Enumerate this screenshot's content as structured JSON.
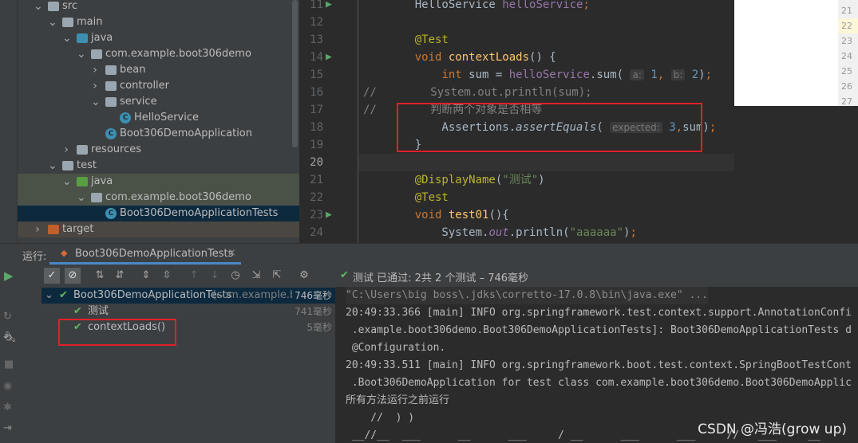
{
  "project_tree": [
    {
      "label": "src",
      "depth": 0,
      "arrow": "down",
      "icon": "folder"
    },
    {
      "label": "main",
      "depth": 1,
      "arrow": "down",
      "icon": "folder"
    },
    {
      "label": "java",
      "depth": 2,
      "arrow": "down",
      "icon": "source-folder"
    },
    {
      "label": "com.example.boot306demo",
      "depth": 3,
      "arrow": "down",
      "icon": "package"
    },
    {
      "label": "bean",
      "depth": 4,
      "arrow": "right",
      "icon": "package"
    },
    {
      "label": "controller",
      "depth": 4,
      "arrow": "right",
      "icon": "package"
    },
    {
      "label": "service",
      "depth": 4,
      "arrow": "down",
      "icon": "package"
    },
    {
      "label": "HelloService",
      "depth": 5,
      "arrow": "",
      "icon": "class"
    },
    {
      "label": "Boot306DemoApplication",
      "depth": 4,
      "arrow": "",
      "icon": "spring-class"
    },
    {
      "label": "resources",
      "depth": 2,
      "arrow": "right",
      "icon": "resources-folder"
    },
    {
      "label": "test",
      "depth": 1,
      "arrow": "down",
      "icon": "folder"
    },
    {
      "label": "java",
      "depth": 2,
      "arrow": "down",
      "icon": "test-folder"
    },
    {
      "label": "com.example.boot306demo",
      "depth": 3,
      "arrow": "down",
      "icon": "package"
    },
    {
      "label": "Boot306DemoApplicationTests",
      "depth": 4,
      "arrow": "",
      "icon": "test-class",
      "selected": true
    },
    {
      "label": "target",
      "depth": 0,
      "arrow": "right",
      "icon": "excluded-folder"
    }
  ],
  "editor": {
    "lines": [
      {
        "n": "11",
        "html": "<span>    HelloService </span><span class='fld'>helloService</span><span class='kw'>;</span>"
      },
      {
        "n": "12",
        "html": ""
      },
      {
        "n": "13",
        "html": "<span class='an'>    @Test</span>"
      },
      {
        "n": "14",
        "html": "<span class='kw'>    void </span><span class='fn'>contextLoads</span>() {"
      },
      {
        "n": "15",
        "html": "        <span class='kw'>int </span>sum = <span class='fld'>helloService</span>.sum( <span class='hint'>a:</span> <span class='num'>1</span><span class='kw'>,</span> <span class='hint'>b:</span> <span class='num'>2</span>)<span class='kw'>;</span>"
      },
      {
        "n": "16",
        "html": "<span class='cm'>//        System.out.println(sum);</span>"
      },
      {
        "n": "17",
        "html": "<span class='cm'>//        判断两个对象是否相等</span>"
      },
      {
        "n": "18",
        "html": "        Assertions.<span class='it'>assertEquals</span>( <span class='hint'>expected:</span> <span class='num'>3</span><span class='kw'>,</span>sum)<span class='kw'>;</span>"
      },
      {
        "n": "19",
        "html": "    }"
      },
      {
        "n": "20",
        "html": ""
      },
      {
        "n": "21",
        "html": "<span class='an'>    @DisplayName</span>(<span class='str'>\"测试\"</span>)"
      },
      {
        "n": "22",
        "html": "<span class='an'>    @Test</span>"
      },
      {
        "n": "23",
        "html": "<span class='kw'>    void </span><span class='fn'>test01</span>(){"
      },
      {
        "n": "24",
        "html": "        System.<span class='fld it'>out</span>.println(<span class='str'>\"aaaaaa\"</span>)<span class='kw'>;</span>"
      }
    ],
    "current_line": "20"
  },
  "popup_line_numbers": [
    "21",
    "22",
    "23",
    "24",
    "25",
    "26",
    "27"
  ],
  "run_panel": {
    "label": "运行:",
    "tab": "Boot306DemoApplicationTests",
    "status": "测试 已通过: 2共 2 个测试 – 746毫秒",
    "tests": [
      {
        "label": "Boot306DemoApplicationTests",
        "suffix": "(com.example.bc",
        "time": "746毫秒",
        "depth": 0
      },
      {
        "label": "测试",
        "time": "741毫秒",
        "depth": 1
      },
      {
        "label": "contextLoads()",
        "time": "5毫秒",
        "depth": 1
      }
    ],
    "console": [
      "\"C:\\Users\\big boss\\.jdks\\corretto-17.0.8\\bin\\java.exe\" ...",
      "20:49:33.366 [main] INFO org.springframework.test.context.support.AnnotationConfi",
      " .example.boot306demo.Boot306DemoApplicationTests]: Boot306DemoApplicationTests d",
      " @Configuration.",
      "20:49:33.511 [main] INFO org.springframework.boot.test.context.SpringBootTestCont",
      " .Boot306DemoApplication for test class com.example.boot306demo.Boot306DemoApplic",
      "所有方法运行之前运行",
      "    //  ) )",
      " __//__  ___      __      ___     / __      ___      ___     //   ___     __"
    ]
  },
  "watermark": "CSDN @冯浩(grow up)",
  "colors": {
    "accent_green": "#5fb85f",
    "highlight_red": "#e0202a",
    "selection": "#0d293e"
  }
}
